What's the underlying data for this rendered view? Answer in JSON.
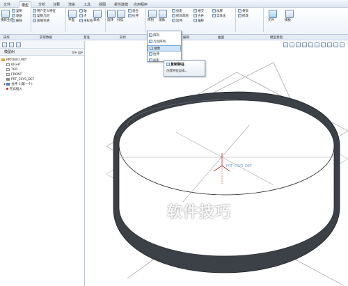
{
  "menu": {
    "tabs": [
      "文件",
      "模型",
      "分析",
      "注释",
      "渲染",
      "工具",
      "视图",
      "柔性建模",
      "应用程序"
    ],
    "active_index": 1
  },
  "ribbon": {
    "col1": [
      "重新生成",
      "复制",
      "粘贴",
      "删除"
    ],
    "col2": [
      "用户定义特征",
      "复制几何",
      "收缩包络"
    ],
    "col3": [
      "平面",
      "轴",
      "点",
      "坐标系",
      "草绘"
    ],
    "col4": [
      "旋转",
      "扫描",
      "混合",
      "拉伸"
    ],
    "col5": [
      "孔",
      "倒圆角",
      "倒角",
      "壳",
      "拔模",
      "筋"
    ],
    "col6": [
      "阵列",
      "镜像"
    ],
    "col7": [
      "投影",
      "修饰草绘",
      "延伸",
      "相交",
      "合并",
      "偏移",
      "加厚",
      "实体化"
    ],
    "col8": [
      "骨架",
      "修改"
    ],
    "col9": [
      "元件",
      "模板"
    ],
    "group_labels": [
      "操作",
      "获取数据",
      "基准",
      "形状",
      "工程",
      "编辑",
      "曲面",
      "模型意图"
    ]
  },
  "dropdown": {
    "items": [
      "阵列",
      "几何阵列",
      "镜像",
      "拉伸",
      "投影"
    ]
  },
  "tooltip": {
    "title": "复制特征",
    "desc": "创建特征副本。"
  },
  "panel": {
    "header": "模型树",
    "tree": [
      {
        "label": "PRT0001.PRT",
        "level": 0,
        "icon": "part"
      },
      {
        "label": "RIGHT",
        "level": 1,
        "icon": "datum-plane"
      },
      {
        "label": "TOP",
        "level": 1,
        "icon": "datum-plane"
      },
      {
        "label": "FRONT",
        "level": 1,
        "icon": "datum-plane"
      },
      {
        "label": "PRT_CSYS_DEF",
        "level": 1,
        "icon": "csys"
      },
      {
        "label": "拉伸 1(第一个)",
        "level": 1,
        "icon": "extrude",
        "expandable": true
      },
      {
        "label": "在此插入",
        "level": 1,
        "icon": "insert"
      }
    ]
  },
  "viewport": {
    "csys_label": "PRT_CSYS_DEF"
  },
  "watermark": "软件技巧",
  "colors": {
    "ribbon_accent": "#2f6fb5",
    "part_shade": "#3e4248",
    "datum": "#8b8b8b",
    "insert_marker": "#d02020"
  }
}
